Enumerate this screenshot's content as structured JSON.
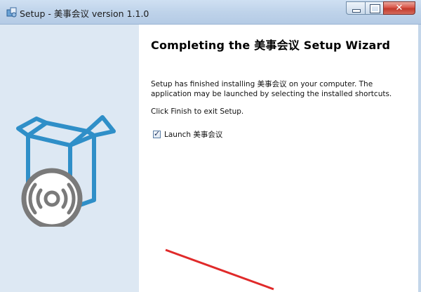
{
  "window": {
    "title": "Setup - 美事会议 version 1.1.0",
    "controls": {
      "minimize": "minimize-icon",
      "maximize": "maximize-icon",
      "close_glyph": "✕"
    }
  },
  "sidebar": {
    "art": "installer-box-disc-icon"
  },
  "wizard": {
    "heading": "Completing the 美事会议 Setup Wizard",
    "message": "Setup has finished installing 美事会议 on your computer. The application may be launched by selecting the installed shortcuts.",
    "instruction": "Click Finish to exit Setup.",
    "launch_option": {
      "label": "Launch 美事会议",
      "checked": true
    }
  },
  "colors": {
    "titlebar": "#bfd3ea",
    "sidepanel": "#dde8f3",
    "art_stroke": "#2f8fc8",
    "disc": "#7a7a7a",
    "arrow": "#e02a2a"
  }
}
